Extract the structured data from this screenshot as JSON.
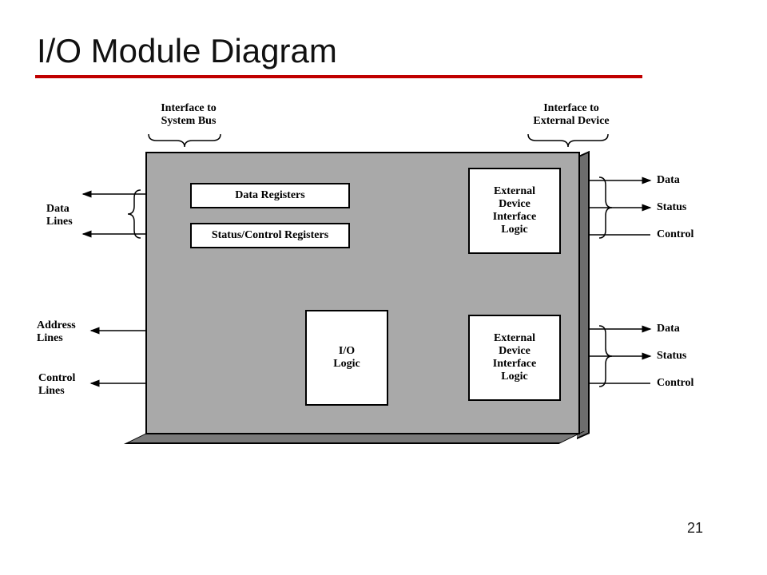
{
  "title": "I/O Module Diagram",
  "page_number": "21",
  "labels": {
    "interface_sysbus": "Interface to\nSystem Bus",
    "interface_extdev": "Interface to\nExternal Device",
    "data_lines": "Data\nLines",
    "address_lines": "Address\nLines",
    "control_lines": "Control\nLines",
    "data": "Data",
    "status": "Status",
    "control": "Control"
  },
  "blocks": {
    "data_registers": "Data Registers",
    "status_control_registers": "Status/Control Registers",
    "io_logic": "I/O\nLogic",
    "ext_dev_interface_logic": "External\nDevice\nInterface\nLogic"
  }
}
